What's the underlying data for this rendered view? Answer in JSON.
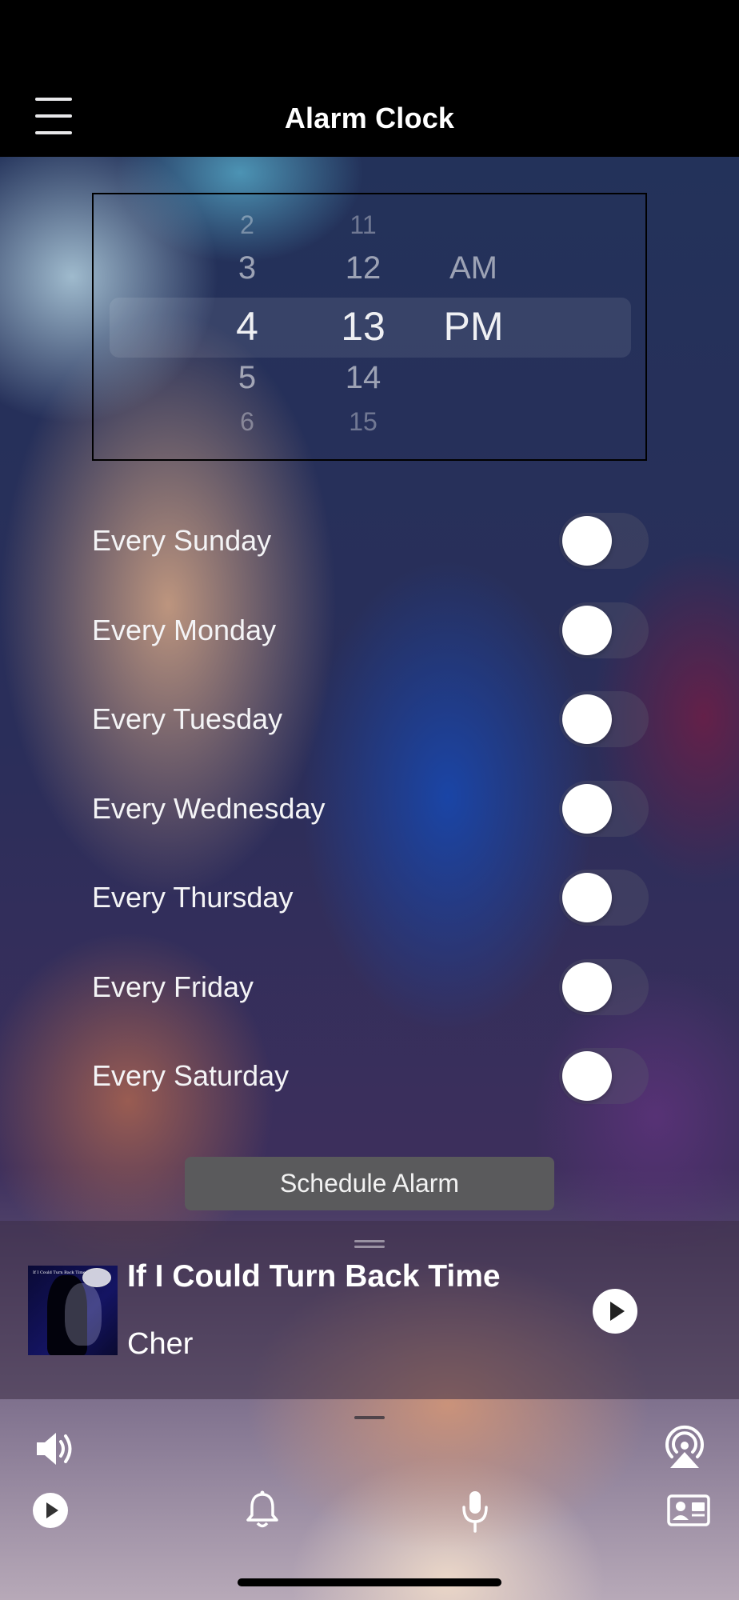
{
  "header": {
    "title": "Alarm Clock",
    "menu_icon": "hamburger-menu-icon"
  },
  "time_picker": {
    "hours": [
      "2",
      "3",
      "4",
      "5",
      "6"
    ],
    "minutes": [
      "11",
      "12",
      "13",
      "14",
      "15"
    ],
    "periods": [
      "AM",
      "PM"
    ],
    "selected": {
      "hour": "4",
      "minute": "13",
      "period": "PM"
    }
  },
  "days": [
    {
      "label": "Every Sunday",
      "enabled": false
    },
    {
      "label": "Every Monday",
      "enabled": false
    },
    {
      "label": "Every Tuesday",
      "enabled": false
    },
    {
      "label": "Every Wednesday",
      "enabled": false
    },
    {
      "label": "Every Thursday",
      "enabled": false
    },
    {
      "label": "Every Friday",
      "enabled": false
    },
    {
      "label": "Every Saturday",
      "enabled": false
    }
  ],
  "schedule_button": {
    "label": "Schedule Alarm"
  },
  "now_playing": {
    "title": "If I Could Turn Back Time",
    "artist": "Cher",
    "album_art_text": "If I Could Turn Back Time"
  },
  "toolbar": {
    "top_left_icon": "speaker-volume-icon",
    "top_right_icon": "airplay-icon",
    "bottom_icons": [
      "play-circle-icon",
      "bell-icon",
      "microphone-icon",
      "contact-card-icon"
    ]
  },
  "colors": {
    "toggle_off": "#3a3a4a",
    "button_gray": "#5a5a5c",
    "header_bg": "#000000"
  }
}
